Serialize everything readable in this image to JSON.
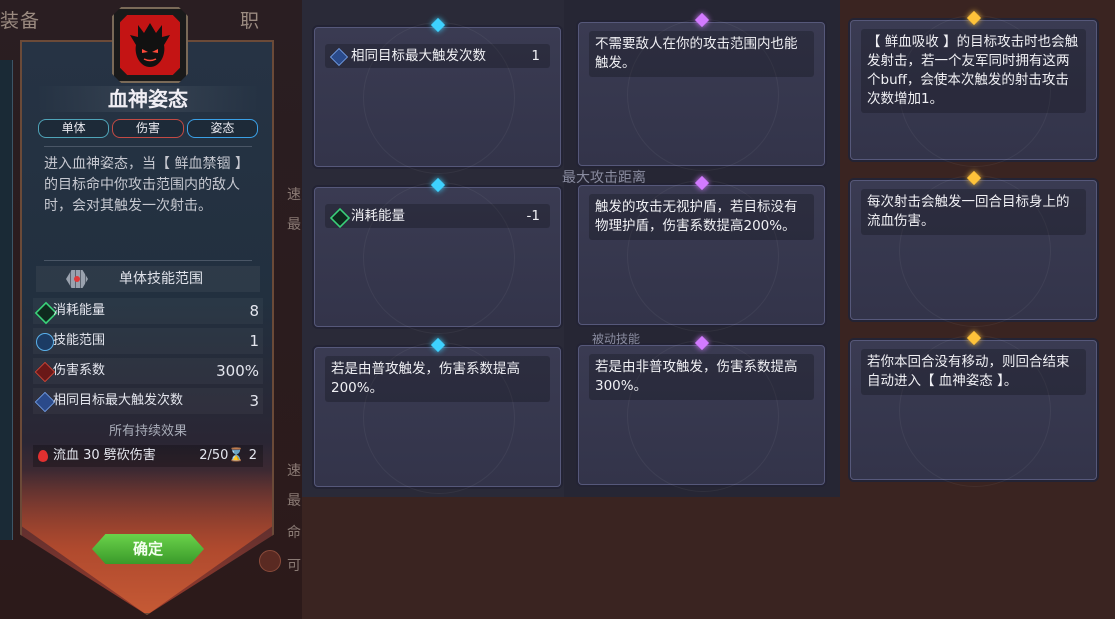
{
  "scene": {
    "top_text_left": "装备",
    "top_text_right": "职",
    "side_texts": [
      "速",
      "最",
      "速",
      "最",
      "命",
      "可"
    ],
    "mid_labels": [
      "最大攻击距离",
      "被动技能"
    ]
  },
  "skill": {
    "name": "血神姿态",
    "tags": [
      "单体",
      "伤害",
      "姿态"
    ],
    "description": "进入血神姿态，当【 鲜血禁锢 】的目标命中你攻击范围内的敌人时，会对其触发一次射击。",
    "range_label": "单体技能范围",
    "stats": [
      {
        "icon": "energy-icon",
        "label": "消耗能量",
        "value": "8"
      },
      {
        "icon": "range-icon",
        "label": "技能范围",
        "value": "1"
      },
      {
        "icon": "damage-icon",
        "label": "伤害系数",
        "value": "300%"
      },
      {
        "icon": "multi-trigger-icon",
        "label": "相同目标最大触发次数",
        "value": "3"
      }
    ],
    "effects_title": "所有持续效果",
    "effect": {
      "label": "流血 30 劈砍伤害",
      "value": "2/50⌛ 2"
    },
    "confirm_label": "确定"
  },
  "cards": {
    "col1": [
      {
        "gem": "blue",
        "stat_icon": "multi-trigger-icon",
        "stat_label": "相同目标最大触发次数",
        "stat_value": "1"
      },
      {
        "gem": "blue",
        "stat_icon": "energy-icon",
        "stat_label": "消耗能量",
        "stat_value": "-1"
      },
      {
        "gem": "blue",
        "text": "若是由普攻触发，伤害系数提高200%。"
      }
    ],
    "col2": [
      {
        "gem": "purple",
        "text": "不需要敌人在你的攻击范围内也能触发。"
      },
      {
        "gem": "purple",
        "text": "触发的攻击无视护盾，若目标没有物理护盾，伤害系数提高200%。"
      },
      {
        "gem": "purple",
        "text": "若是由非普攻触发，伤害系数提高300%。"
      }
    ],
    "col3": [
      {
        "gem": "gold",
        "text": "【 鲜血吸收 】的目标攻击时也会触发射击，若一个友军同时拥有这两个buff，会使本次触发的射击攻击次数增加1。"
      },
      {
        "gem": "gold",
        "text": "每次射击会触发一回合目标身上的流血伤害。"
      },
      {
        "gem": "gold",
        "text": "若你本回合没有移动，则回合结束自动进入【 血神姿态 】。"
      }
    ]
  },
  "colors": {
    "accent_blue": "#3ed2ff",
    "accent_purple": "#d27aff",
    "accent_gold": "#ffc23a",
    "confirm_green": "#4ab83a"
  }
}
